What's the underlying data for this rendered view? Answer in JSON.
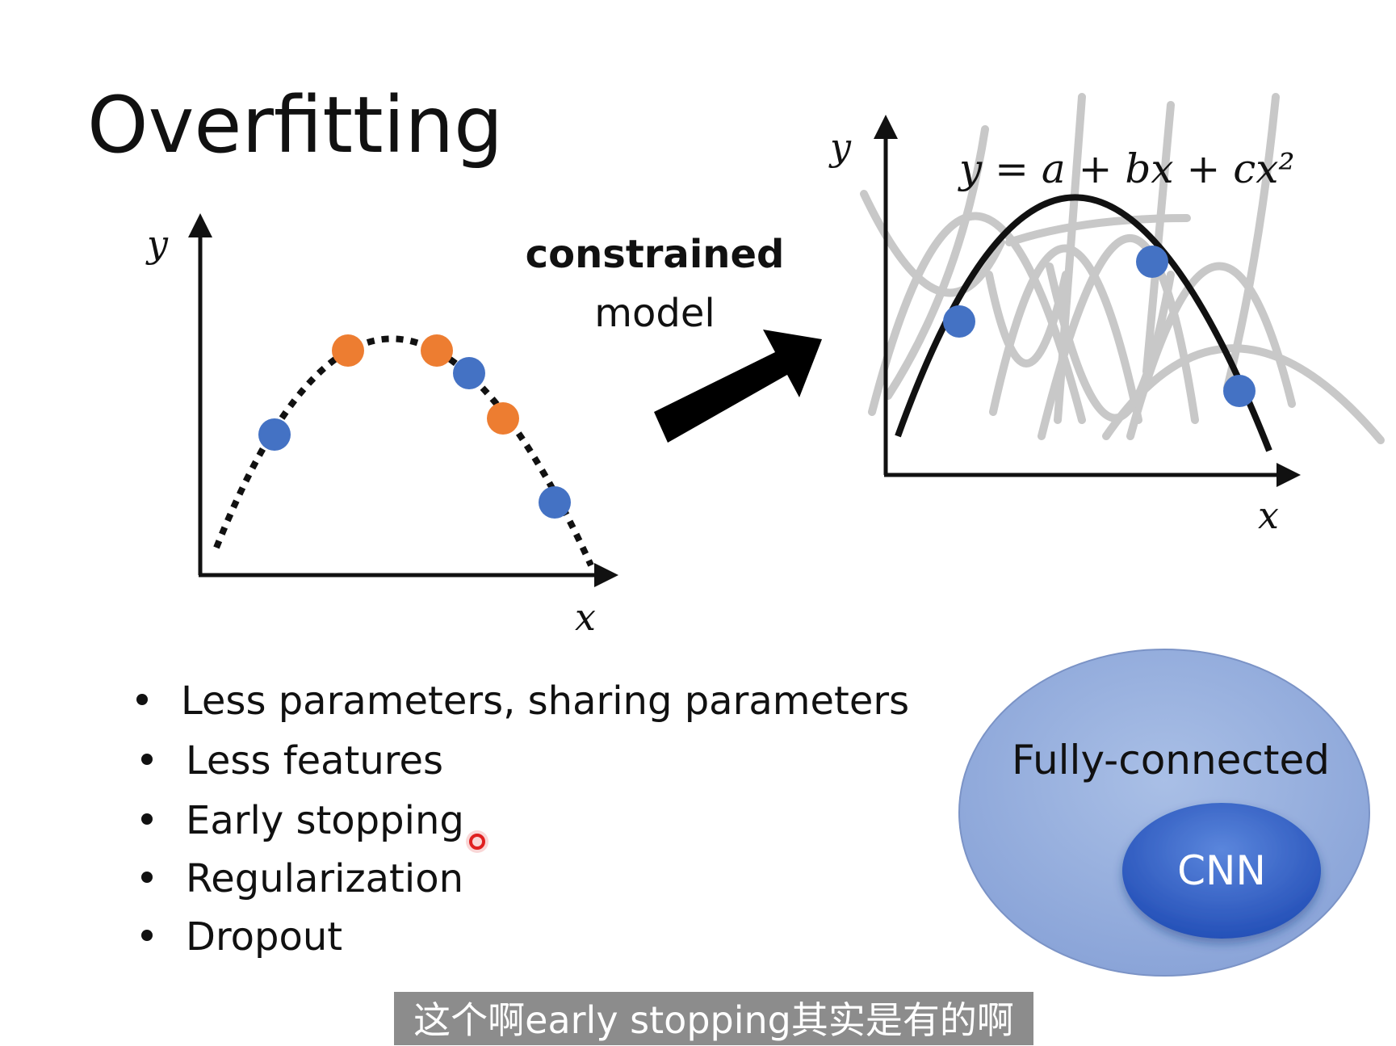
{
  "title": "Overfitting",
  "left_plot": {
    "y_label": "y",
    "x_label": "x",
    "curve_style": "dotted",
    "point_colors": {
      "blue": "#4472C4",
      "orange": "#ED7D31"
    }
  },
  "middle": {
    "line1": "constrained",
    "line2": "model"
  },
  "right_plot": {
    "y_label": "y",
    "x_label": "x",
    "equation": "y = a + bx + cx²",
    "point_color": "#4472C4",
    "background_curves_color": "#c8c8c8"
  },
  "bullets": [
    "Less parameters, sharing parameters",
    "Less features",
    "Early stopping",
    "Regularization",
    "Dropout"
  ],
  "venn": {
    "outer_label": "Fully-connected",
    "inner_label": "CNN",
    "outer_color": "#8FAADC",
    "inner_color": "#2F5FC4"
  },
  "subtitle": "这个啊early stopping其实是有的啊",
  "colors": {
    "subtitle_bg": "#8c8c8c",
    "pointer": "#e02020"
  }
}
